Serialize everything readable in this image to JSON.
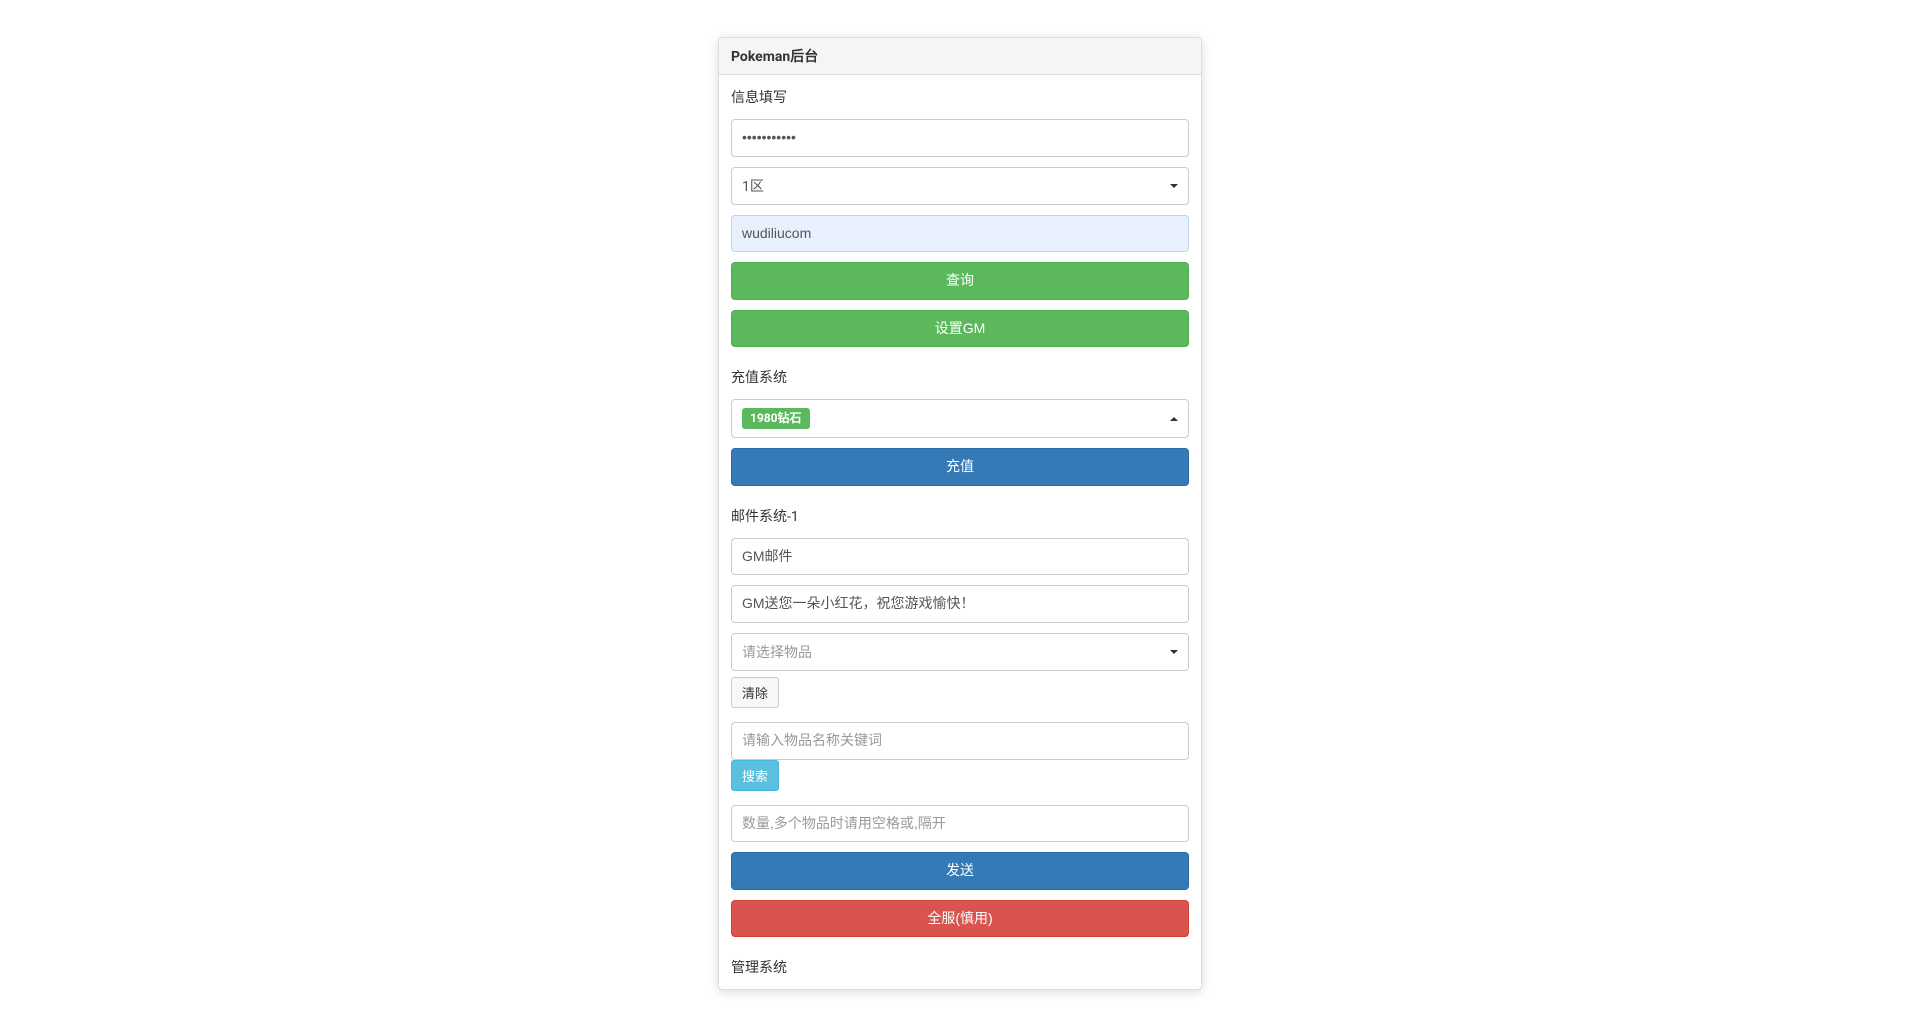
{
  "panel": {
    "title": "Pokeman后台"
  },
  "info_section": {
    "label": "信息填写",
    "password_masked": "•••••••••••",
    "zone_selected": "1区",
    "username_value": "wudiliucom",
    "query_button": "查询",
    "set_gm_button": "设置GM"
  },
  "recharge_section": {
    "label": "充值系统",
    "product_selected": "1980钻石",
    "recharge_button": "充值"
  },
  "mail_section": {
    "label": "邮件系统-1",
    "subject_value": "GM邮件",
    "body_value": "GM送您一朵小红花，祝您游戏愉快！",
    "item_select_placeholder": "请选择物品",
    "clear_button": "清除",
    "keyword_placeholder": "请输入物品名称关键词",
    "search_button": "搜索",
    "quantity_placeholder": "数量,多个物品时请用空格或,隔开",
    "send_button": "发送",
    "send_all_button": "全服(慎用)"
  },
  "admin_section": {
    "label": "管理系统"
  }
}
